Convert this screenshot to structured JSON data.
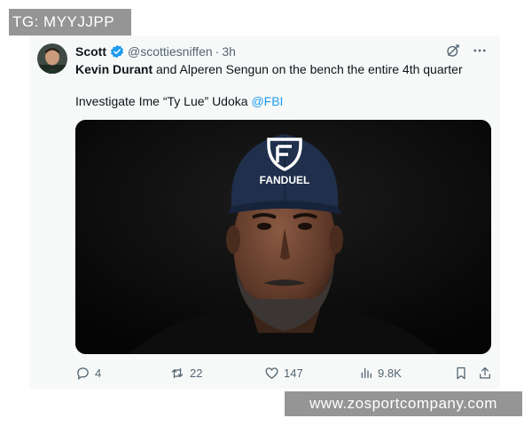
{
  "watermarks": {
    "top_left": "TG: MYYJJPP",
    "bottom_right": "www.zosportcompany.com"
  },
  "tweet": {
    "author_name": "Scott",
    "handle": "@scottiesniffen",
    "separator": "·",
    "time": "3h",
    "line1": {
      "mention": "Kevin Durant",
      "rest": " and Alperen Sengun on the bench the entire 4th quarter"
    },
    "line2": {
      "text": "Investigate Ime “Ty Lue” Udoka ",
      "link": "@FBI"
    },
    "image": {
      "cap_logo": "FANDUEL",
      "alt": ""
    },
    "stats": {
      "replies": "4",
      "reposts": "22",
      "likes": "147",
      "views": "9.8K"
    }
  },
  "colors": {
    "verified": "#1d9bf0",
    "link": "#1d9bf0",
    "secondary_text": "#536471",
    "card_bg": "#f7f9f9"
  },
  "icons": {
    "verified": "verified-badge-icon",
    "grok": "grok-icon",
    "more": "more-dots-icon",
    "reply": "reply-icon",
    "repost": "repost-icon",
    "like": "like-icon",
    "views": "views-icon",
    "bookmark": "bookmark-icon",
    "share": "share-icon"
  }
}
